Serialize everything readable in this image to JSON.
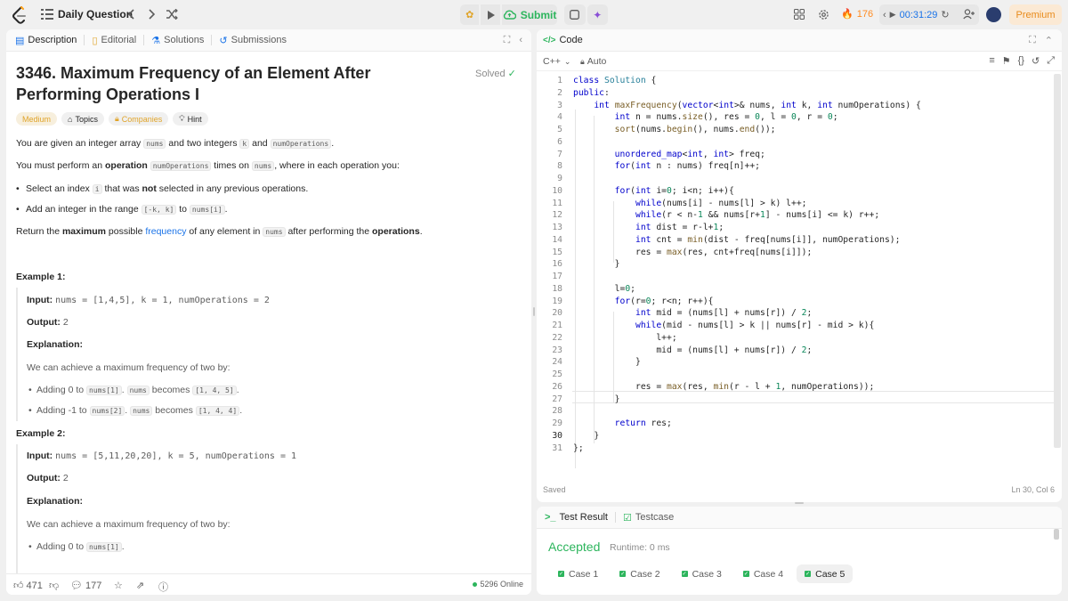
{
  "topbar": {
    "title": "Daily Question",
    "submit_label": "Submit",
    "streak": "176",
    "timer": "00:31:29",
    "premium_label": "Premium"
  },
  "left_tabs": [
    {
      "label": "Description",
      "icon": "description-icon"
    },
    {
      "label": "Editorial",
      "icon": "book-icon"
    },
    {
      "label": "Solutions",
      "icon": "flask-icon"
    },
    {
      "label": "Submissions",
      "icon": "history-icon"
    }
  ],
  "problem": {
    "title": "3346. Maximum Frequency of an Element After Performing Operations I",
    "solved_label": "Solved",
    "chips": {
      "difficulty": "Medium",
      "topics": "Topics",
      "companies": "Companies",
      "hint": "Hint"
    },
    "p1": {
      "a": "You are given an integer array ",
      "c1": "nums",
      "b": " and two integers ",
      "c2": "k",
      "d": " and ",
      "c3": "numOperations",
      "e": "."
    },
    "p2": {
      "a": "You must perform an ",
      "strong": "operation",
      "b": " ",
      "c1": "numOperations",
      "c": " times on ",
      "c2": "nums",
      "d": ", where in each operation you:"
    },
    "b1": {
      "a": "Select an index ",
      "c1": "i",
      "b": " that was ",
      "strong": "not",
      "c": " selected in any previous operations."
    },
    "b2": {
      "a": "Add an integer in the range ",
      "c1": "[-k, k]",
      "b": " to ",
      "c2": "nums[i]",
      "c": "."
    },
    "p3": {
      "a": "Return the ",
      "strong": "maximum",
      "b": " possible ",
      "link": "frequency",
      "c": " of any element in ",
      "c1": "nums",
      "d": " after performing the ",
      "strong2": "operations",
      "e": "."
    },
    "ex1": {
      "title": "Example 1:",
      "input_label": "Input:",
      "input": "nums = [1,4,5], k = 1, numOperations = 2",
      "output_label": "Output:",
      "output": "2",
      "expl_label": "Explanation:",
      "expl": "We can achieve a maximum frequency of two by:",
      "bullets": [
        {
          "a": "Adding 0 to ",
          "c1": "nums[1]",
          "b": ". ",
          "c2": "nums",
          "c": " becomes ",
          "c3": "[1, 4, 5]",
          "d": "."
        },
        {
          "a": "Adding -1 to ",
          "c1": "nums[2]",
          "b": ". ",
          "c2": "nums",
          "c": " becomes ",
          "c3": "[1, 4, 4]",
          "d": "."
        }
      ]
    },
    "ex2": {
      "title": "Example 2:",
      "input_label": "Input:",
      "input": "nums = [5,11,20,20], k = 5, numOperations = 1",
      "output_label": "Output:",
      "output": "2",
      "expl_label": "Explanation:",
      "expl": "We can achieve a maximum frequency of two by:",
      "bullet": {
        "a": "Adding 0 to ",
        "c1": "nums[1]",
        "b": "."
      }
    }
  },
  "left_footer": {
    "likes": "471",
    "comments": "177",
    "online": "5296 Online"
  },
  "code_panel": {
    "title": "Code",
    "language": "C++",
    "mode": "Auto",
    "saved": "Saved",
    "cursor_pos": "Ln 30, Col 6"
  },
  "code_lines": [
    "class Solution {",
    "public:",
    "    int maxFrequency(vector<int>& nums, int k, int numOperations) {",
    "        int n = nums.size(), res = 0, l = 0, r = 0;",
    "        sort(nums.begin(), nums.end());",
    "",
    "        unordered_map<int, int> freq;",
    "        for(int n : nums) freq[n]++;",
    "",
    "        for(int i=0; i<n; i++){",
    "            while(nums[i] - nums[l] > k) l++;",
    "            while(r < n-1 && nums[r+1] - nums[i] <= k) r++;",
    "            int dist = r-l+1;",
    "            int cnt = min(dist - freq[nums[i]], numOperations);",
    "            res = max(res, cnt+freq[nums[i]]);",
    "        }",
    "",
    "        l=0;",
    "        for(r=0; r<n; r++){",
    "            int mid = (nums[l] + nums[r]) / 2;",
    "            while(mid - nums[l] > k || nums[r] - mid > k){",
    "                l++;",
    "                mid = (nums[l] + nums[r]) / 2;",
    "            }",
    "",
    "            res = max(res, min(r - l + 1, numOperations));",
    "        }",
    "",
    "        return res;",
    "    }",
    "};"
  ],
  "test_panel": {
    "tab_result": "Test Result",
    "tab_testcase": "Testcase",
    "status": "Accepted",
    "runtime": "Runtime: 0 ms",
    "cases": [
      "Case 1",
      "Case 2",
      "Case 3",
      "Case 4",
      "Case 5"
    ]
  },
  "colors": {
    "accepted": "#2db55d",
    "link": "#1a73e8",
    "medium": "#e0a42a",
    "streak": "#ff8a1f"
  }
}
